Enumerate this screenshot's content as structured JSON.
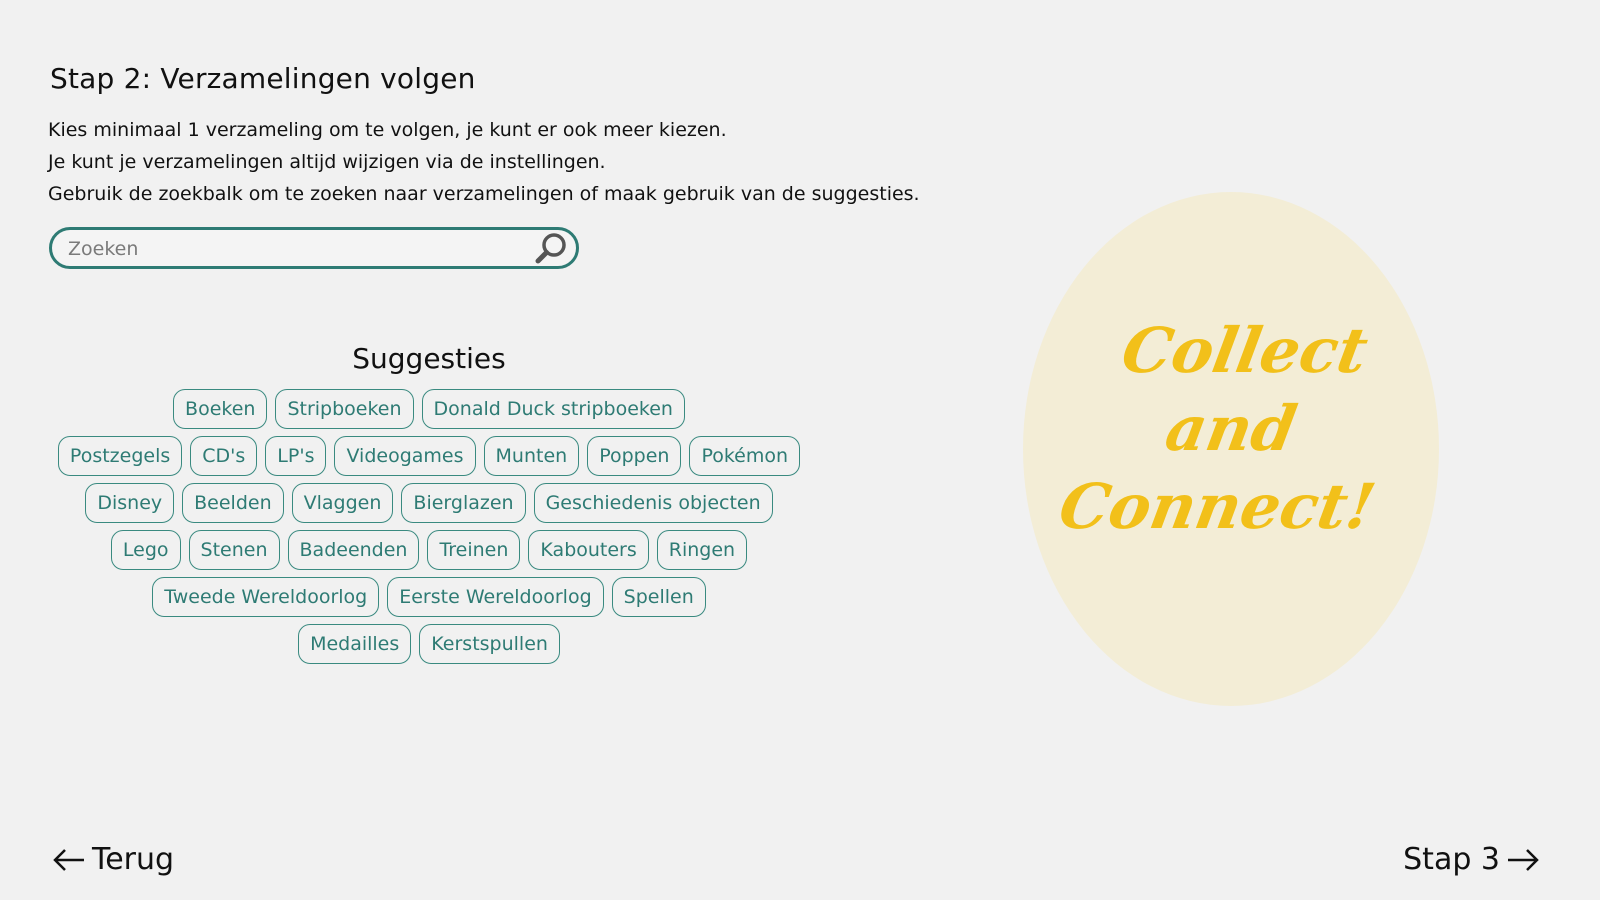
{
  "header": {
    "title": "Stap 2: Verzamelingen volgen",
    "instructions": [
      "Kies minimaal 1 verzameling om te volgen, je kunt er ook meer kiezen.",
      "Je kunt je verzamelingen altijd wijzigen via de instellingen.",
      "Gebruik de zoekbalk om te zoeken naar verzamelingen of maak gebruik van de suggesties."
    ]
  },
  "search": {
    "placeholder": "Zoeken",
    "value": "",
    "icon": "search-icon"
  },
  "suggestions": {
    "title": "Suggesties",
    "rows": [
      [
        "Boeken",
        "Stripboeken",
        "Donald Duck stripboeken"
      ],
      [
        "Postzegels",
        "CD's",
        "LP's",
        "Videogames",
        "Munten",
        "Poppen",
        "Pokémon"
      ],
      [
        "Disney",
        "Beelden",
        "Vlaggen",
        "Bierglazen",
        "Geschiedenis objecten"
      ],
      [
        "Lego",
        "Stenen",
        "Badeenden",
        "Treinen",
        "Kabouters",
        "Ringen"
      ],
      [
        "Tweede Wereldoorlog",
        "Eerste Wereldoorlog",
        "Spellen"
      ],
      [
        "Medailles",
        "Kerstspullen"
      ]
    ]
  },
  "badge": {
    "lines": [
      "Collect",
      "and",
      "Connect!"
    ]
  },
  "navigation": {
    "back_label": "Terug",
    "next_label": "Stap 3"
  },
  "colors": {
    "accent": "#2e7b74",
    "badge_background": "#f3edd6",
    "badge_text": "#f2c01a",
    "page_background": "#f1f1f1"
  }
}
